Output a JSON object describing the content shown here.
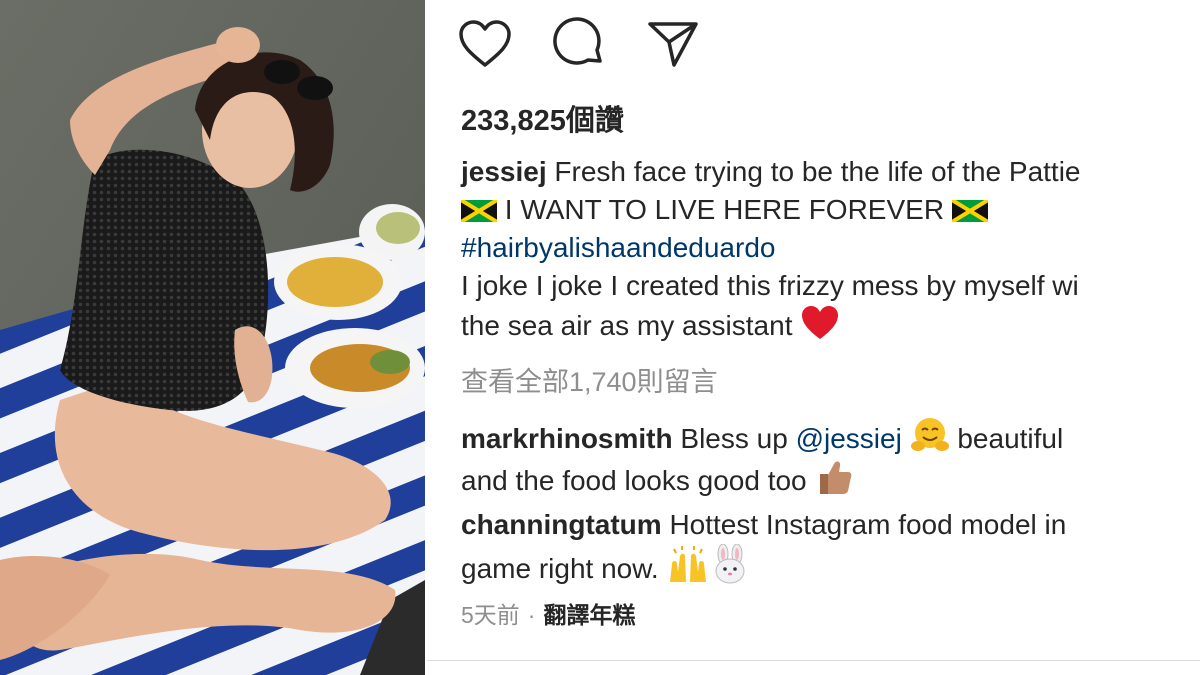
{
  "post": {
    "likes": "233,825個讚",
    "author": "jessiej",
    "caption_line1": " Fresh face trying to be the life of the Pattie",
    "caption_line2": " I WANT TO LIVE HERE FOREVER ",
    "hashtag": "#hairbyalishaandeduardo",
    "caption_line3": "I joke I joke I created this frizzy mess by myself wi",
    "caption_line4": "the sea air as my assistant ",
    "view_all_comments": "查看全部1,740則留言",
    "timestamp": "5天前",
    "separator": "·",
    "translate_label": "翻譯年糕"
  },
  "comments": [
    {
      "user": "markrhinosmith",
      "text_a": " Bless up ",
      "mention": "@jessiej",
      "text_b": " beautiful",
      "text_c": "and the food looks good too "
    },
    {
      "user": "channingtatum",
      "text_a": " Hottest Instagram food model in",
      "text_b": "game right now. "
    }
  ],
  "icons": {
    "like": "heart-icon",
    "comment": "comment-bubble-icon",
    "share": "paper-plane-icon"
  },
  "colors": {
    "link": "#00376b",
    "muted": "#8e8e8e",
    "text": "#262626",
    "towel_blue": "#1f3f9a"
  }
}
